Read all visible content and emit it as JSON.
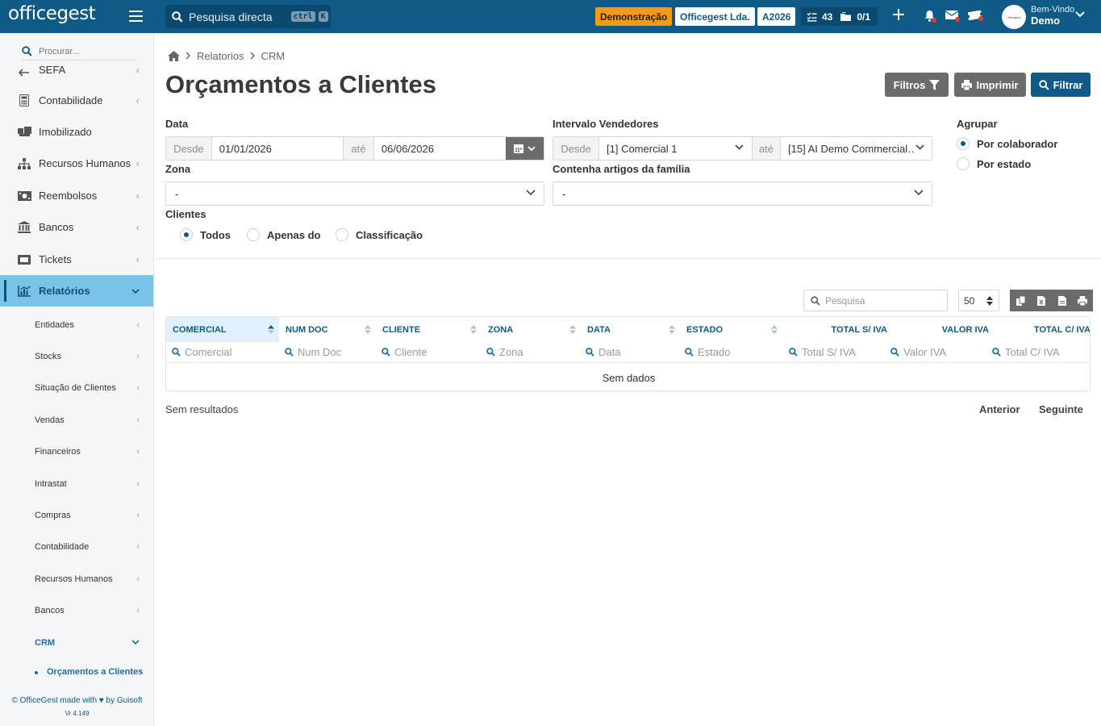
{
  "topbar": {
    "logo": "officegest",
    "search_placeholder": "Pesquisa directa",
    "kbd_ctrl": "ctrl",
    "kbd_k": "K",
    "badge_demo": "Demonstração",
    "company": "Officegest Lda.",
    "year": "A2026",
    "tasks_count": "43",
    "folders_count": "0/1",
    "welcome": "Bem-Vindo",
    "user": "Demo",
    "colors": {
      "bar": "#0f5a87",
      "demo": "#f39c12",
      "notif": "#e53935"
    }
  },
  "sidebar": {
    "search_placeholder": "Procurar...",
    "partial_item": "SEFA",
    "items": [
      {
        "label": "Contabilidade",
        "icon": "calculator-icon"
      },
      {
        "label": "Imobilizado",
        "icon": "boxes-icon"
      },
      {
        "label": "Recursos Humanos",
        "icon": "sitemap-icon"
      },
      {
        "label": "Reembolsos",
        "icon": "money-icon"
      },
      {
        "label": "Bancos",
        "icon": "bank-icon"
      },
      {
        "label": "Tickets",
        "icon": "ticket-icon"
      },
      {
        "label": "Relatórios",
        "icon": "chart-icon"
      }
    ],
    "sub_items": [
      "Entidades",
      "Stocks",
      "Situação de Clientes",
      "Vendas",
      "Financeiros",
      "Intrastat",
      "Compras",
      "Contabilidade",
      "Recursos Humanos",
      "Bancos",
      "CRM"
    ],
    "active_leaf": "Orçamentos a Clientes",
    "footer": "© OfficeGest made with ♥ by Guisoft",
    "version": "Vr 4.149"
  },
  "breadcrumb": [
    "Relatorios",
    "CRM"
  ],
  "page": {
    "title": "Orçamentos a Clientes",
    "buttons": {
      "filtros": "Filtros",
      "imprimir": "Imprimir",
      "filtrar": "Filtrar"
    }
  },
  "form": {
    "data_label": "Data",
    "desde": "Desde",
    "ate": "até",
    "date_from": "01/01/2026",
    "date_to": "06/06/2026",
    "vendedores_label": "Intervalo Vendedores",
    "vendedor_from": "[1] Comercial 1",
    "vendedor_to": "[15] AI Demo Commercial…",
    "agrupar_label": "Agrupar",
    "agrupar_options": [
      "Por colaborador",
      "Por estado"
    ],
    "agrupar_selected": "Por colaborador",
    "zona_label": "Zona",
    "zona_value": "-",
    "familia_label": "Contenha artigos da família",
    "familia_value": "-",
    "clientes_label": "Clientes",
    "clientes_options": [
      "Todos",
      "Apenas do",
      "Classificação"
    ],
    "clientes_selected": "Todos"
  },
  "table": {
    "search_placeholder": "Pesquisa",
    "page_size": "50",
    "columns": [
      "COMERCIAL",
      "NUM DOC",
      "CLIENTE",
      "ZONA",
      "DATA",
      "ESTADO",
      "TOTAL S/ IVA",
      "VALOR IVA",
      "TOTAL C/ IVA"
    ],
    "filters": [
      "Comercial",
      "Num Doc",
      "Cliente",
      "Zona",
      "Data",
      "Estado",
      "Total S/ IVA",
      "Valor IVA",
      "Total C/ IVA"
    ],
    "empty_text": "Sem dados",
    "results_text": "Sem resultados",
    "prev": "Anterior",
    "next": "Seguinte"
  }
}
